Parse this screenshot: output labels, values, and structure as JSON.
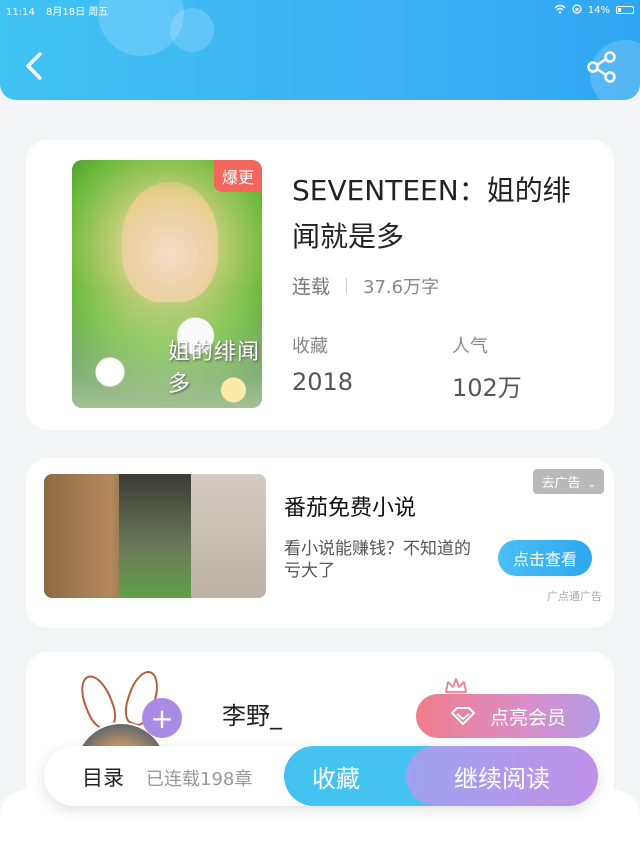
{
  "status": {
    "time": "11:14",
    "date": "8月18日 周五",
    "battery": "14%"
  },
  "header": {
    "back_icon": "chevron-left-icon",
    "share_icon": "share-icon",
    "color": "#3fb9f4"
  },
  "book": {
    "hot_badge": "爆更",
    "title": "SEVENTEEN：姐的绯闻就是多",
    "status": "连载",
    "word_count": "37.6万字",
    "stats": [
      {
        "label": "收藏",
        "value": "2018"
      },
      {
        "label": "人气",
        "value": "102万"
      }
    ],
    "cover_text": "姐的绯闻多"
  },
  "ad": {
    "dismiss_label": "去广告",
    "title": "番茄免费小说",
    "description": "看小说能赚钱？不知道的亏大了",
    "cta_label": "点击查看",
    "source": "广点通广告"
  },
  "author": {
    "name": "李野_",
    "follow_icon": "plus-icon",
    "vip_label": "点亮会员",
    "vip_icon": "diamond-icon"
  },
  "bottom_bar": {
    "toc_label": "目录",
    "chapter_count": "已连载198章",
    "favorite_label": "收藏",
    "read_label": "继续阅读"
  }
}
